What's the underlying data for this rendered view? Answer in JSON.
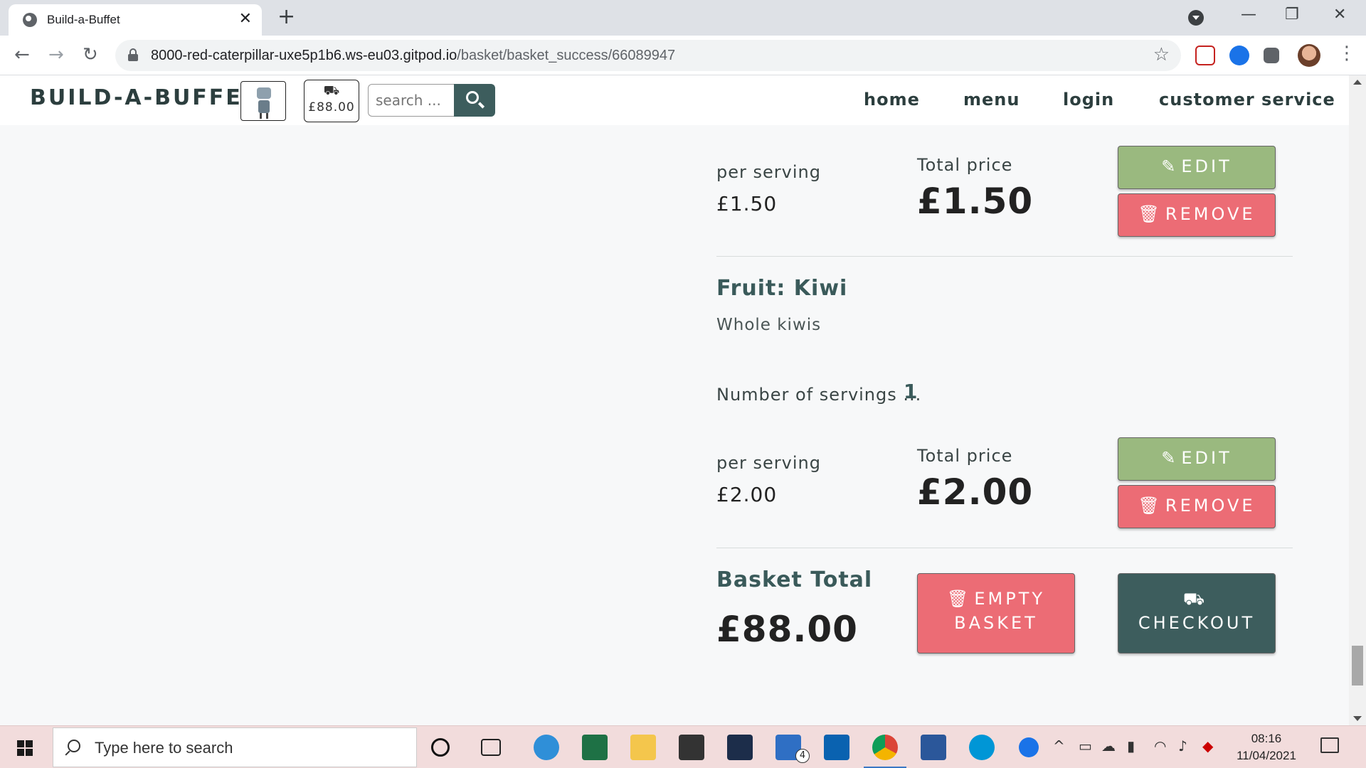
{
  "browser": {
    "tab_title": "Build-a-Buffet",
    "tab_close": "✕",
    "new_tab": "+",
    "url_host": "8000-red-caterpillar-uxe5p1b6.ws-eu03.gitpod.io",
    "url_path": "/basket/basket_success/66089947",
    "window_controls": [
      "—",
      "❐",
      "✕"
    ]
  },
  "site": {
    "brand": "BUILD-A-BUFFET",
    "basket_amount": "£88.00",
    "search_placeholder": "search ...",
    "nav": [
      "home",
      "menu",
      "login",
      "customer service"
    ]
  },
  "basket": {
    "items": [
      {
        "per_serving_label": "per serving",
        "per_serving_price": "£1.50",
        "total_label": "Total price",
        "total_price": "£1.50",
        "edit_label": "EDIT",
        "remove_label": "REMOVE"
      },
      {
        "title": "Fruit: Kiwi",
        "description": "Whole kiwis",
        "servings_label": "Number of servings ...",
        "servings": "1",
        "per_serving_label": "per serving",
        "per_serving_price": "£2.00",
        "total_label": "Total price",
        "total_price": "£2.00",
        "edit_label": "EDIT",
        "remove_label": "REMOVE"
      }
    ],
    "total_label": "Basket Total",
    "total_value": "£88.00",
    "empty_label_1": "EMPTY",
    "empty_label_2": "BASKET",
    "checkout_label": "CHECKOUT"
  },
  "taskbar": {
    "search_text": "Type here to search",
    "time": "08:16",
    "date": "11/04/2021",
    "mail_badge": "4"
  },
  "icons": {
    "edit": "edit-icon",
    "trash": "trash-icon",
    "basket": "basket-icon"
  },
  "colors": {
    "edit_button": "#9ab97f",
    "remove_button": "#ec6c75",
    "checkout_button": "#3d5d5d",
    "brand_text": "#2c3e3e"
  }
}
